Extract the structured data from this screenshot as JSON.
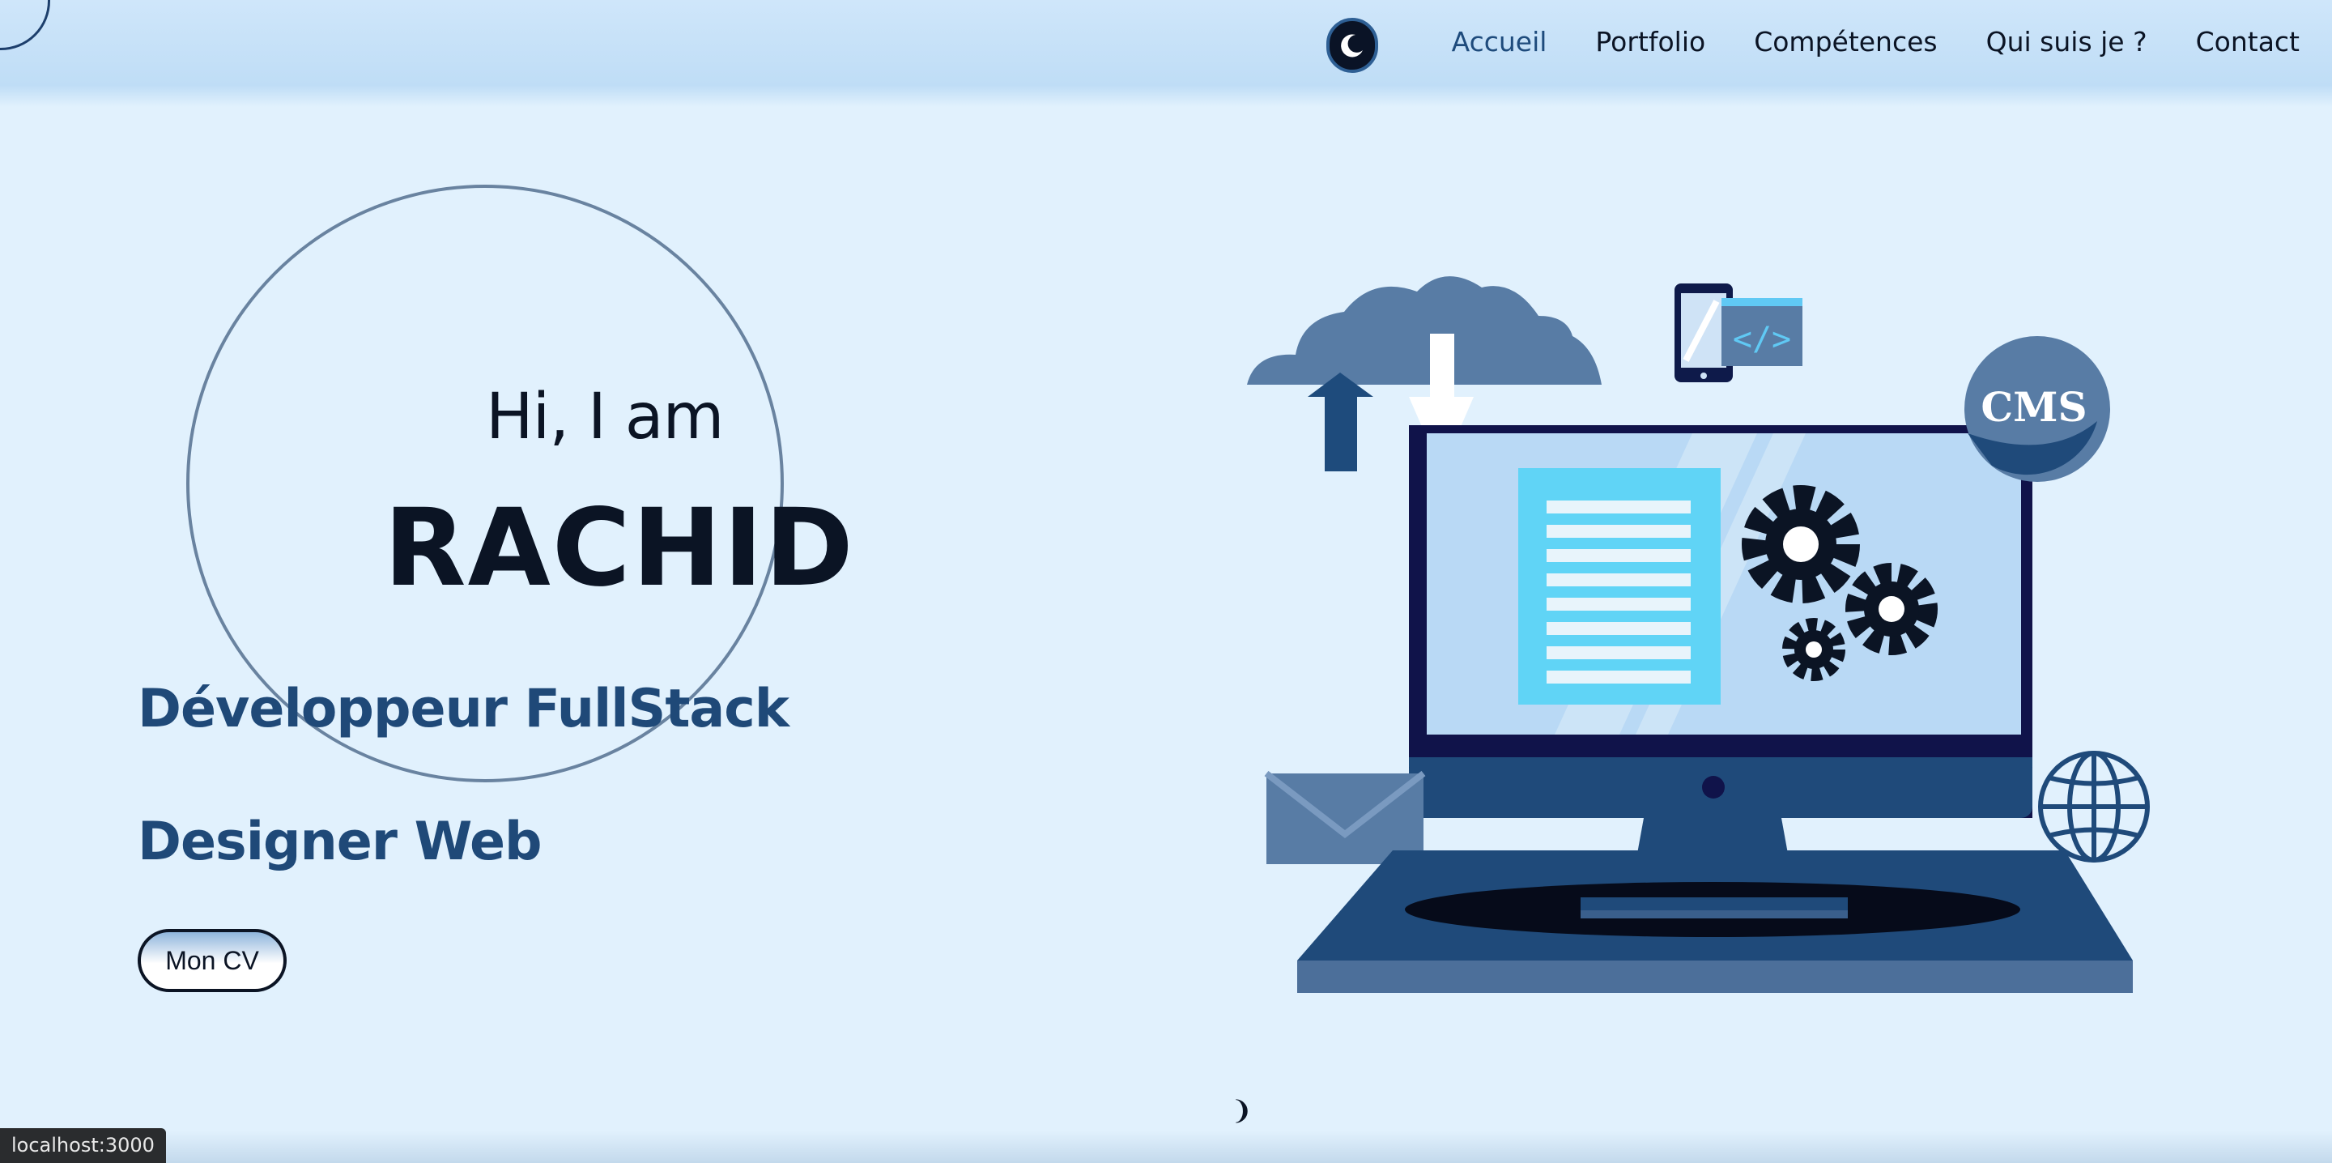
{
  "nav": {
    "items": [
      {
        "label": "Accueil",
        "active": true
      },
      {
        "label": "Portfolio",
        "active": false
      },
      {
        "label": "Compétences",
        "active": false
      },
      {
        "label": "Qui suis je ?",
        "active": false
      },
      {
        "label": "Contact",
        "active": false
      }
    ],
    "theme_toggle_icon": "moon-icon"
  },
  "hero": {
    "greeting": "Hi, I am",
    "name": "RACHID",
    "roles": [
      "Développeur FullStack",
      "Designer Web"
    ],
    "cv_button": "Mon CV"
  },
  "illustration": {
    "badge": "CMS",
    "code_symbol": "</>"
  },
  "colors": {
    "background": "#e1f1fd",
    "accent": "#1f4978",
    "dark": "#0b1424"
  },
  "status_url": "localhost:3000"
}
